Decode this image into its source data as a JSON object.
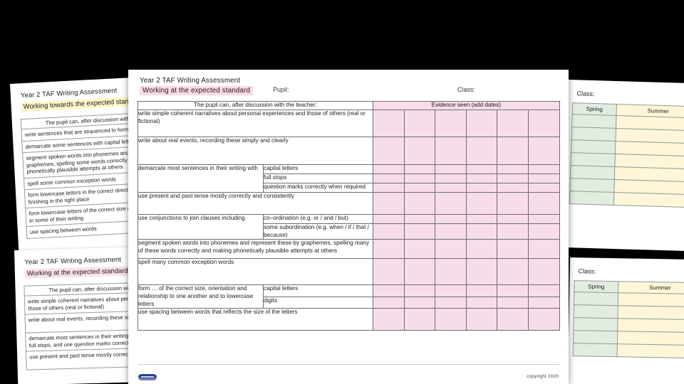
{
  "background_sheets": {
    "top_left": {
      "title": "Year 2 TAF Writing Assessment",
      "subtitle": "Working towards the expected standard",
      "highlight_color": "#fdf6c8",
      "table_header": "The pupil can, after discussion with the teacher:",
      "rows": [
        "write sentences that are sequenced to form a short narrative",
        "demarcate some sentences with capital letters and full stops",
        "segment spoken words into phonemes and represent these by graphemes, spelling some words correctly and making phonetically plausible attempts at others",
        "spell some common exception words",
        "form lowercase letters in the correct direction, starting and finishing in the right place",
        "form lowercase letters of the correct size relative to one another in some of their writing",
        "use spacing between words"
      ]
    },
    "bottom_left": {
      "title": "Year 2 TAF Writing Assessment",
      "subtitle": "Working at the expected standard",
      "highlight_color": "#fbdfe9",
      "table_header": "The pupil can, after discussion with the teacher:",
      "rows": [
        "write simple coherent narratives about personal experiences and those of others (real or fictional)",
        "write about real events, recording these simply and clearly",
        "demarcate most sentences in their writing with capital letters and full stops, and use question marks correctly when required",
        "use present and past tense mostly correctly and consistently"
      ]
    },
    "top_right": {
      "class_label": "Class:",
      "columns": [
        "Spring",
        "Summer"
      ],
      "column_colors": [
        "#e2ece1",
        "#fdf6d8"
      ],
      "row_count": 8
    },
    "bottom_right": {
      "class_label": "Class:",
      "columns": [
        "Spring",
        "Summer"
      ],
      "column_colors": [
        "#e2ece1",
        "#fdf6d8"
      ],
      "row_count": 6
    }
  },
  "main_sheet": {
    "title": "Year 2 TAF Writing Assessment",
    "standard": "Working at the expected standard",
    "standard_highlight": "#fbd9e7",
    "pupil_label": "Pupil:",
    "class_label": "Class:",
    "table": {
      "header_criteria": "The pupil can, after discussion with the teacher:",
      "header_evidence": "Evidence seen (add dates)",
      "evidence_column_count": 6,
      "evidence_color": "#f7dcea",
      "rows": [
        {
          "criterion": "write simple coherent narratives about personal experiences and those of others (real or fictional)",
          "sub": null,
          "height": 42
        },
        {
          "criterion": "write about real events, recording these simply and clearly",
          "sub": null,
          "height": 42
        },
        {
          "criterion": "demarcate most sentences in their writing with",
          "sub": [
            "capital letters",
            "full stops",
            "question marks correctly when required"
          ],
          "height": 60
        },
        {
          "criterion": "use present and past tense mostly correctly and consistently",
          "sub": null,
          "height": 36
        },
        {
          "criterion": "use conjunctions to join clauses including",
          "sub": [
            "co–ordination (e.g. or / and / but)",
            "some subordination (e.g. when / if / that / because)"
          ],
          "height": 42
        },
        {
          "criterion": "segment spoken words into phonemes and represent these by graphemes, spelling many of these words correctly and making phonetically plausible attempts at others",
          "sub": null,
          "height": 34
        },
        {
          "criterion": "spell many common exception words",
          "sub": null,
          "height": 40
        },
        {
          "criterion": "form … of the correct size, orientation and relationship to one another and to lowercase letters",
          "sub": [
            "capital letters",
            "digits"
          ],
          "height": 40
        },
        {
          "criterion": "use spacing between words that reflects the size of the letters",
          "sub": null,
          "height": 36
        }
      ]
    },
    "footer": {
      "copyright": "copyright 2020",
      "logo": "plazoom-logo"
    }
  }
}
